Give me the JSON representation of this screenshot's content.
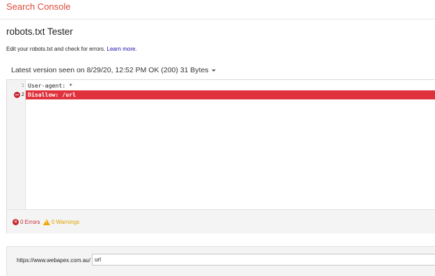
{
  "header": {
    "brand": "Search Console"
  },
  "page": {
    "title": "robots.txt Tester",
    "intro_text": "Edit your robots.txt and check for errors.",
    "learn_more": "Learn more."
  },
  "version": {
    "label": "Latest version seen on 8/29/20, 12:52 PM OK (200) 31 Bytes"
  },
  "editor": {
    "lines": [
      {
        "number": "1",
        "text": "User-agent: *",
        "error": false
      },
      {
        "number": "2",
        "text": "Disallow: /url",
        "error": true
      }
    ]
  },
  "status": {
    "errors": "0 Errors",
    "warnings": "0 Warnings"
  },
  "tester": {
    "url_prefix": "https://www.webapex.com.au/",
    "url_value": "url"
  },
  "colors": {
    "brand": "#dd4b39",
    "error_line": "#e0323d",
    "error": "#c4262e",
    "warning": "#e0a000",
    "link": "#1a0dab"
  },
  "icons": [
    "error-icon",
    "x-circle-icon",
    "warning-icon",
    "caret-down-icon"
  ]
}
